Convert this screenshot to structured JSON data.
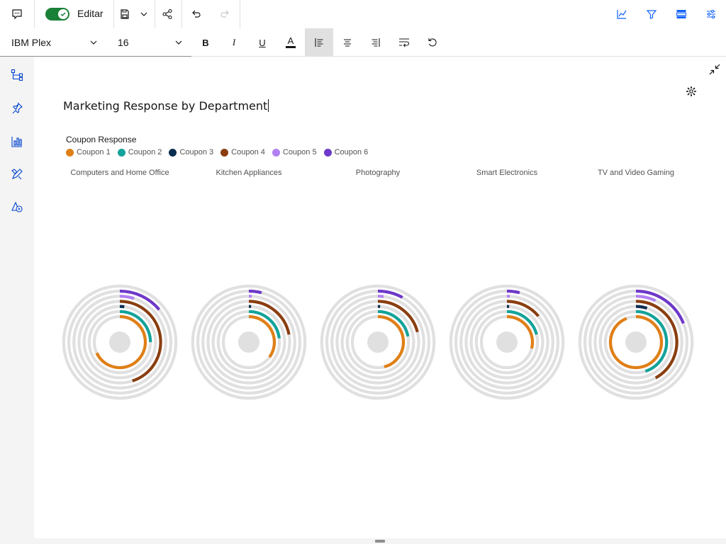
{
  "toolbar": {
    "edit_label": "Editar",
    "edit_toggle_on": true
  },
  "format": {
    "font_family": "IBM Plex",
    "font_size": "16",
    "bold": "B",
    "italic": "I",
    "underline": "U",
    "font_color": "A"
  },
  "page": {
    "title": "Marketing Response by Department"
  },
  "colors": {
    "accent_green": "#198038",
    "track": "#e0e0e0"
  },
  "chart_data": {
    "type": "radial-bar",
    "legend_title": "Coupon Response",
    "series": [
      {
        "name": "Coupon 1",
        "color": "#e07f16"
      },
      {
        "name": "Coupon 2",
        "color": "#12a39a"
      },
      {
        "name": "Coupon 3",
        "color": "#0b2d4f"
      },
      {
        "name": "Coupon 4",
        "color": "#8a3e10"
      },
      {
        "name": "Coupon 5",
        "color": "#b280f2"
      },
      {
        "name": "Coupon 6",
        "color": "#6e38c9"
      }
    ],
    "categories": [
      "Computers and Home Office",
      "Kitchen Appliances",
      "Photography",
      "Smart Electronics",
      "TV and Video Gaming"
    ],
    "values": [
      [
        0.68,
        0.25,
        0.02,
        0.45,
        0.05,
        0.14
      ],
      [
        0.35,
        0.23,
        0.01,
        0.22,
        0.01,
        0.04
      ],
      [
        0.46,
        0.22,
        0.01,
        0.21,
        0.02,
        0.08
      ],
      [
        0.29,
        0.21,
        0.01,
        0.14,
        0.01,
        0.04
      ],
      [
        0.94,
        0.45,
        0.05,
        0.42,
        0.07,
        0.19
      ]
    ]
  }
}
